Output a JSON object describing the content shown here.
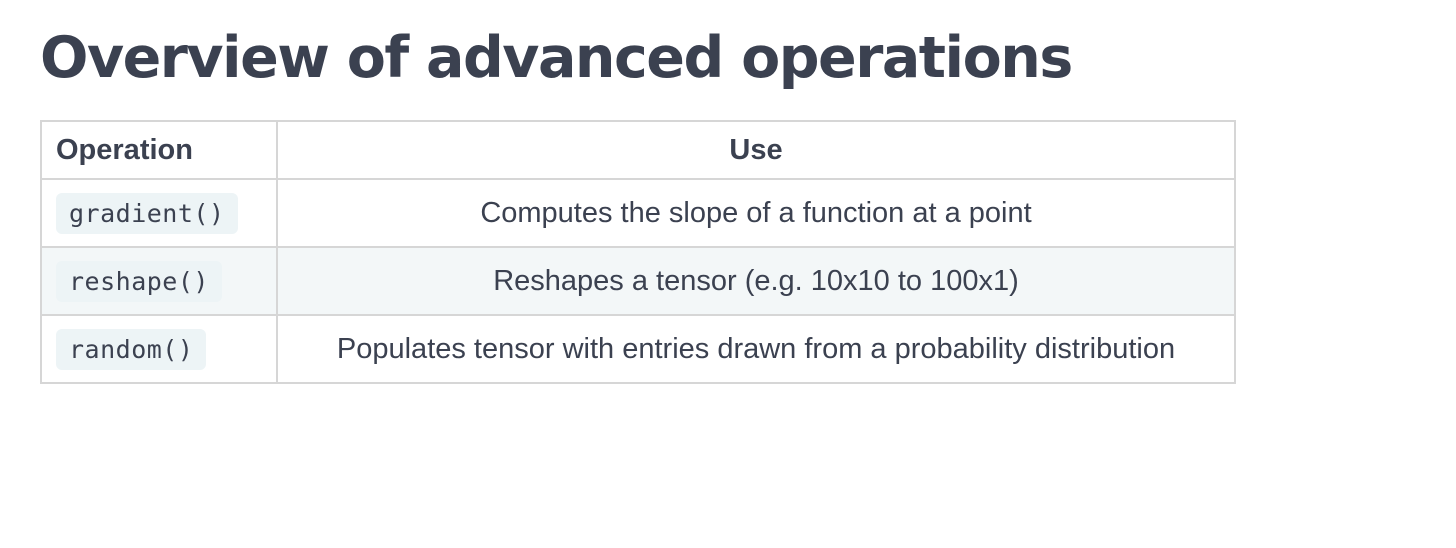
{
  "document": {
    "title": "Overview of advanced operations"
  },
  "table": {
    "headers": {
      "operation": "Operation",
      "use": "Use"
    },
    "rows": [
      {
        "operation": "gradient()",
        "use": "Computes the slope of a function at a point"
      },
      {
        "operation": "reshape()",
        "use": "Reshapes a tensor (e.g. 10x10 to 100x1)"
      },
      {
        "operation": "random()",
        "use": "Populates tensor with entries drawn from a probability distribution"
      }
    ]
  },
  "colors": {
    "text": "#3b4150",
    "border": "#d6d6d6",
    "alt_row_bg": "#f3f7f8",
    "code_bg": "#edf4f6"
  }
}
